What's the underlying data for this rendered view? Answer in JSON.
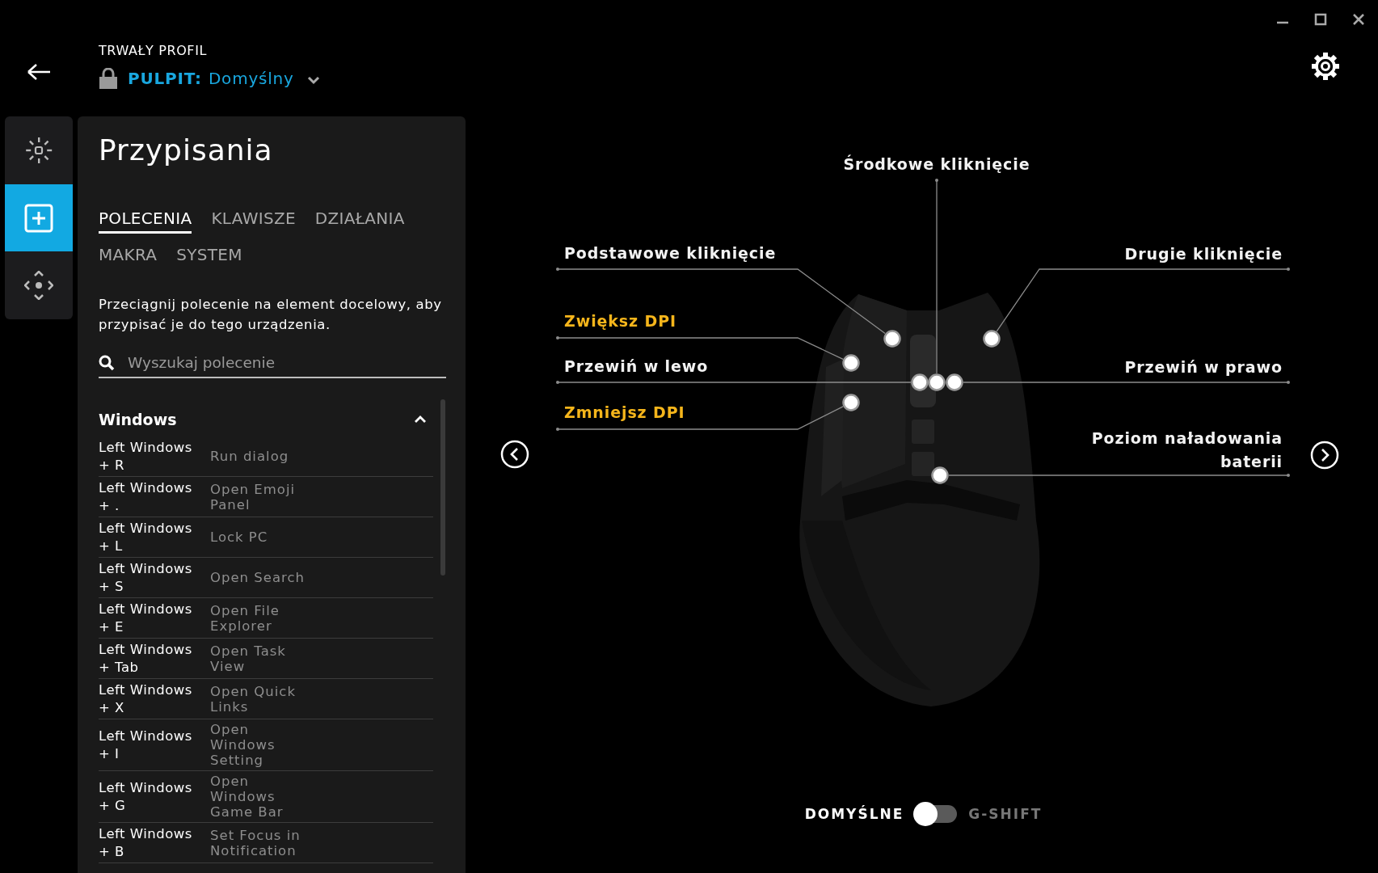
{
  "header": {
    "profile_caption": "TRWAŁY PROFIL",
    "profile_device": "PULPIT:",
    "profile_name": "Domyślny",
    "locked": true
  },
  "rail": [
    {
      "selected": false
    },
    {
      "selected": true
    },
    {
      "selected": false
    }
  ],
  "panel": {
    "title": "Przypisania",
    "tabs": [
      {
        "label": "POLECENIA",
        "selected": true
      },
      {
        "label": "KLAWISZE",
        "selected": false
      },
      {
        "label": "DZIAŁANIA",
        "selected": false
      },
      {
        "label": "MAKRA",
        "selected": false
      },
      {
        "label": "SYSTEM",
        "selected": false
      }
    ],
    "hint": "Przeciągnij polecenie na element docelowy, aby przypisać je do tego urządzenia.",
    "search": {
      "placeholder": "Wyszukaj polecenie"
    },
    "groups": [
      {
        "title": "Windows",
        "expanded": true,
        "commands": [
          {
            "keys": "Left Windows + R",
            "action": "Run dialog"
          },
          {
            "keys": "Left Windows + .",
            "action": "Open Emoji Panel"
          },
          {
            "keys": "Left Windows + L",
            "action": "Lock PC"
          },
          {
            "keys": "Left Windows + S",
            "action": "Open Search"
          },
          {
            "keys": "Left Windows + E",
            "action": "Open File Explorer"
          },
          {
            "keys": "Left Windows + Tab",
            "action": "Open Task View"
          },
          {
            "keys": "Left Windows + X",
            "action": "Open Quick Links"
          },
          {
            "keys": "Left Windows + I",
            "action": "Open Windows Setting"
          },
          {
            "keys": "Left Windows + G",
            "action": "Open Windows Game Bar"
          },
          {
            "keys": "Left Windows + B",
            "action": "Set Focus in Notification"
          }
        ]
      }
    ]
  },
  "diagram": {
    "callouts": [
      {
        "label": "Środkowe kliknięcie",
        "assigned": false
      },
      {
        "label": "Podstawowe kliknięcie",
        "assigned": false
      },
      {
        "label": "Drugie kliknięcie",
        "assigned": false
      },
      {
        "label": "Zwiększ DPI",
        "assigned": true
      },
      {
        "label": "Przewiń w lewo",
        "assigned": false
      },
      {
        "label": "Przewiń w prawo",
        "assigned": false
      },
      {
        "label": "Zmniejsz DPI",
        "assigned": true
      },
      {
        "label": "Poziom naładowania baterii",
        "assigned": false
      }
    ]
  },
  "mode_toggle": {
    "left_label": "DOMYŚLNE",
    "right_label": "G-SHIFT",
    "on": false
  }
}
